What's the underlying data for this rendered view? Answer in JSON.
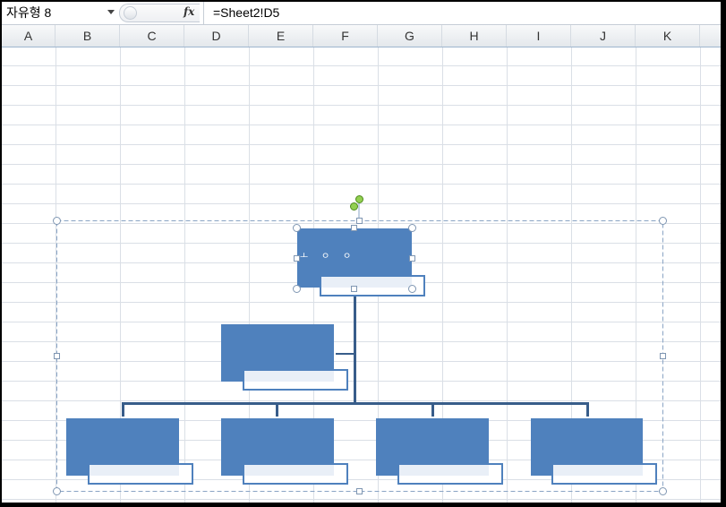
{
  "namebox": {
    "value": "자유형 8"
  },
  "formula": {
    "fx_label": "fx",
    "value": "=Sheet2!D5"
  },
  "columns": [
    "A",
    "B",
    "C",
    "D",
    "E",
    "F",
    "G",
    "H",
    "I",
    "J",
    "K"
  ],
  "smartart": {
    "type": "organization-chart",
    "selected_shape_text": "ㅗ ㅇ ㅇ",
    "fill_color": "#4f81bd",
    "connector_color": "#385d8a"
  }
}
